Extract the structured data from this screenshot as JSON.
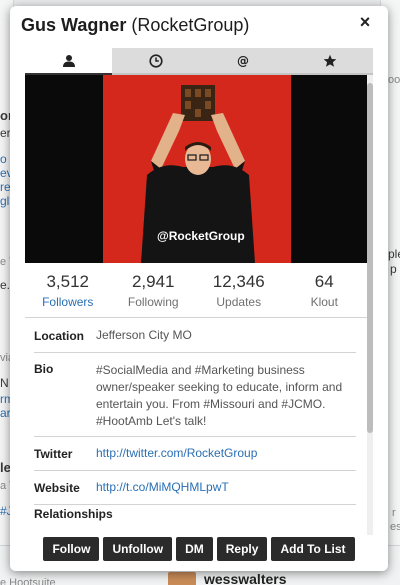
{
  "background": {
    "left_fragments": [
      "orp",
      "er.",
      "o",
      "ev",
      "re",
      "gl",
      "e T",
      "e. c",
      "via",
      "N",
      "rm",
      "ar",
      "le",
      "a T",
      "#J",
      "e Hootsuite"
    ],
    "right_fragments": [
      "oo",
      "ple",
      "p",
      "r",
      "es"
    ],
    "bottom_user": "wesswalters"
  },
  "modal": {
    "name": "Gus Wagner",
    "handle_paren": "(RocketGroup)",
    "close_label": "×"
  },
  "tabs": [
    {
      "icon": "person-icon",
      "active": true
    },
    {
      "icon": "clock-icon",
      "active": false
    },
    {
      "icon": "at-icon",
      "active": false
    },
    {
      "icon": "star-icon",
      "active": false
    }
  ],
  "photo": {
    "watermark": "@RocketGroup",
    "colors": {
      "frame": "#0a0a0a",
      "backdrop": "#d5281c"
    }
  },
  "stats": [
    {
      "value": "3,512",
      "label": "Followers",
      "link": true
    },
    {
      "value": "2,941",
      "label": "Following",
      "link": false
    },
    {
      "value": "12,346",
      "label": "Updates",
      "link": false
    },
    {
      "value": "64",
      "label": "Klout",
      "link": false
    }
  ],
  "details": {
    "location_label": "Location",
    "location": "Jefferson City MO",
    "bio_label": "Bio",
    "bio": "#SocialMedia and #Marketing business owner/speaker seeking to educate, inform and entertain you. From #Missouri and #JCMO. #HootAmb Let's talk!",
    "twitter_label": "Twitter",
    "twitter": "http://twitter.com/RocketGroup",
    "website_label": "Website",
    "website": "http://t.co/MiMQHMLpwT",
    "relationships_label": "Relationships"
  },
  "actions": [
    "Follow",
    "Unfollow",
    "DM",
    "Reply",
    "Add To List"
  ],
  "colors": {
    "link": "#2a6fb5",
    "button": "#2b2b2b"
  }
}
